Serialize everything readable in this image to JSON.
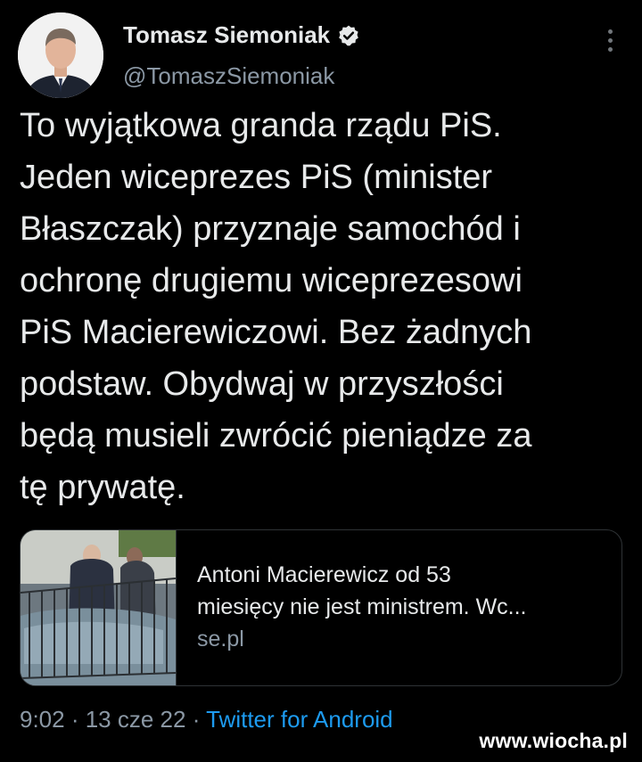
{
  "user": {
    "display_name": "Tomasz Siemoniak",
    "handle": "@TomaszSiemoniak",
    "verified": true
  },
  "tweet": {
    "lines": [
      "To wyjątkowa granda rządu PiS.",
      "Jeden wiceprezes PiS (minister",
      "Błaszczak) przyznaje samochód i",
      "ochronę drugiemu wiceprezesowi",
      "PiS Macierewiczowi. Bez żadnych",
      "podstaw. Obydwaj w przyszłości",
      "będą musieli zwrócić pieniądze za",
      "tę prywatę."
    ]
  },
  "link_card": {
    "title_line1": "Antoni Macierewicz od 53",
    "title_line2": "miesięcy nie jest ministrem. Wc...",
    "domain": "se.pl"
  },
  "meta": {
    "time": "9:02",
    "separator1": " · ",
    "date": "13 cze 22",
    "separator2": " · ",
    "source": "Twitter for Android"
  },
  "watermark": "www.wiocha.pl",
  "icons": {
    "verified": "verified-badge-icon",
    "more": "more-options-icon"
  },
  "colors": {
    "background": "#000000",
    "text": "#e7e9ea",
    "secondary": "#8b98a5",
    "link": "#1d9bf0"
  }
}
